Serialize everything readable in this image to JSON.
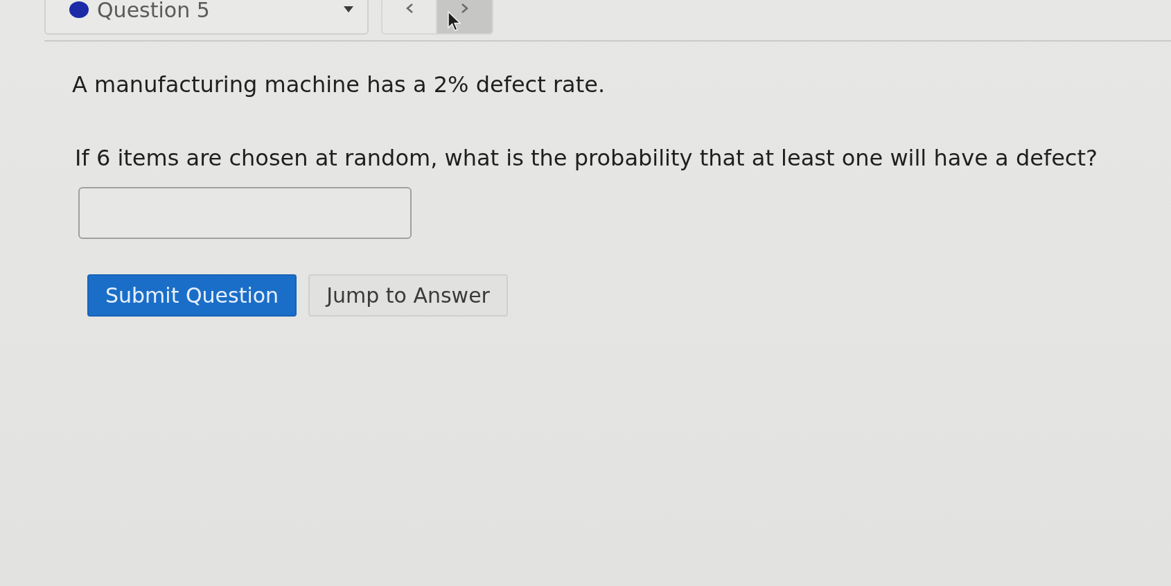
{
  "question_nav": {
    "dropdown": {
      "label": "Question 5"
    },
    "nav_buttons": [
      {
        "kind": "previous",
        "hovered": false
      },
      {
        "kind": "next",
        "hovered": true
      }
    ]
  },
  "question": {
    "paragraphs": [
      "A manufacturing machine has a 2% defect rate.",
      "If 6 items are chosen at random, what is the probability that at least one will have a defect?"
    ]
  },
  "buttons": [
    {
      "label": "Submit Question",
      "kind": "primary"
    },
    {
      "label": "Jump to Answer",
      "kind": "secondary"
    }
  ]
}
